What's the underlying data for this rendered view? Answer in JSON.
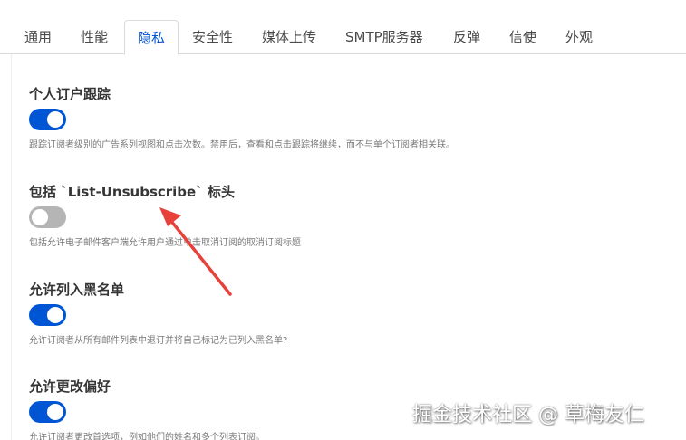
{
  "tabs": [
    {
      "label": "通用",
      "active": false
    },
    {
      "label": "性能",
      "active": false
    },
    {
      "label": "隐私",
      "active": true
    },
    {
      "label": "安全性",
      "active": false
    },
    {
      "label": "媒体上传",
      "active": false
    },
    {
      "label": "SMTP服务器",
      "active": false
    },
    {
      "label": "反弹",
      "active": false
    },
    {
      "label": "信使",
      "active": false
    },
    {
      "label": "外观",
      "active": false
    }
  ],
  "settings": [
    {
      "label": "个人订户跟踪",
      "enabled": true,
      "help": "跟踪订阅者级别的广告系列视图和点击次数。禁用后，查看和点击跟踪将继续，而不与单个订阅者相关联。"
    },
    {
      "label": "包括 `List-Unsubscribe` 标头",
      "enabled": false,
      "help": "包括允许电子邮件客户端允许用户通过单击取消订阅的取消订阅标题"
    },
    {
      "label": "允许列入黑名单",
      "enabled": true,
      "help": "允许订阅者从所有邮件列表中退订并将自己标记为已列入黑名单?"
    },
    {
      "label": "允许更改偏好",
      "enabled": true,
      "help": "允许订阅者更改首选项，例如他们的姓名和多个列表订阅。"
    }
  ],
  "watermark": "掘金技术社区 @ 草梅友仁",
  "colors": {
    "accent": "#0055d4",
    "toggle_off": "#b5b5b5",
    "annotation_arrow": "#e8413a"
  }
}
